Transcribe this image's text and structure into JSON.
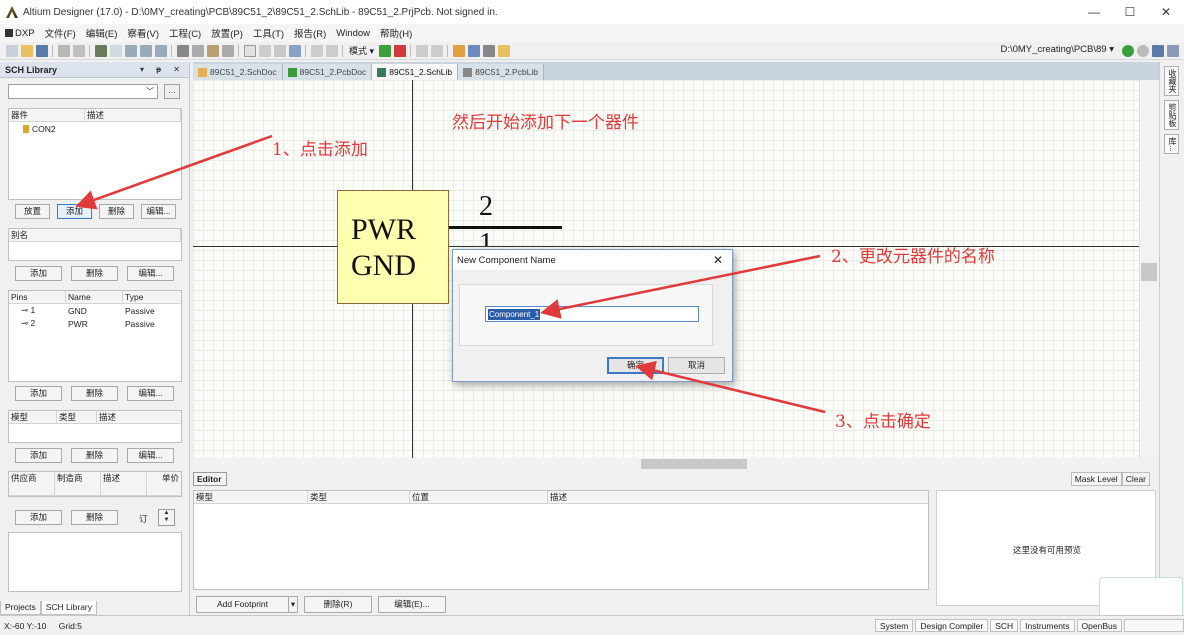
{
  "window": {
    "title": "Altium Designer (17.0) - D:\\0MY_creating\\PCB\\89C51_2\\89C51_2.SchLib - 89C51_2.PrjPcb. Not signed in.",
    "controls": [
      "—",
      "☐",
      "✕"
    ]
  },
  "menu": [
    "DXP",
    "文件(F)",
    "编辑(E)",
    "察看(V)",
    "工程(C)",
    "放置(P)",
    "工具(T)",
    "报告(R)",
    "Window",
    "帮助(H)"
  ],
  "toolbar": {
    "mode_label": "模式 ▾",
    "path": "D:\\0MY_creating\\PCB\\89 ▾"
  },
  "left_panel": {
    "title": "SCH Library",
    "header_buttons": "▾ ᵽ ✕",
    "component_list": {
      "headers": [
        "器件",
        "描述"
      ],
      "rows": [
        {
          "name": "CON2"
        }
      ]
    },
    "component_buttons": [
      "放置",
      "添加",
      "删除",
      "编辑..."
    ],
    "alias_list": {
      "headers": [
        "别名"
      ]
    },
    "alias_buttons": [
      "添加",
      "删除",
      "编辑..."
    ],
    "pins_list": {
      "headers": [
        "Pins",
        "Name",
        "Type"
      ],
      "rows": [
        {
          "pin": "1",
          "name": "GND",
          "type": "Passive"
        },
        {
          "pin": "2",
          "name": "PWR",
          "type": "Passive"
        }
      ]
    },
    "pin_buttons": [
      "添加",
      "删除",
      "编辑..."
    ],
    "model_list": {
      "headers": [
        "模型",
        "类型",
        "描述"
      ]
    },
    "model_buttons": [
      "添加",
      "删除",
      "编辑..."
    ],
    "supplier_list": {
      "headers": [
        "供应商",
        "制造商",
        "描述",
        "单价"
      ]
    },
    "supplier_buttons": [
      "添加",
      "删除"
    ],
    "order_label": "订",
    "bottom_tabs": [
      "Projects",
      "SCH Library"
    ]
  },
  "doc_tabs": [
    "89C51_2.SchDoc",
    "89C51_2.PcbDoc",
    "89C51_2.SchLib",
    "89C51_2.PcbLib"
  ],
  "right_strip": {
    "tabs": [
      "收藏夹",
      "剪贴板",
      "库..."
    ]
  },
  "canvas": {
    "component": {
      "pin_names": [
        "PWR",
        "GND"
      ],
      "pin_numbers": [
        "2",
        "1"
      ]
    },
    "annotations": [
      "然后开始添加下一个器件",
      "1、点击添加",
      "2、更改元器件的名称",
      "3、点击确定"
    ]
  },
  "dialog": {
    "title": "New Component Name",
    "input_value": "Component_1",
    "ok_label": "确定",
    "cancel_label": "取消"
  },
  "editor": {
    "tab": "Editor",
    "right_tabs": [
      "Mask Level",
      "Clear"
    ],
    "headers": [
      "模型",
      "类型",
      "位置",
      "描述"
    ],
    "preview_text": "这里没有可用预览",
    "buttons": [
      "Add Footprint",
      "删除(R)",
      "编辑(E)..."
    ]
  },
  "status": {
    "coords": "X:-60 Y:-10",
    "grid": "Grid:5",
    "tabs": [
      "System",
      "Design Compiler",
      "SCH",
      "Instruments",
      "OpenBus"
    ]
  },
  "colors": {
    "annotation": "#e03a3a",
    "component_fill": "#ffffb0",
    "selection": "#2a5ba8"
  }
}
